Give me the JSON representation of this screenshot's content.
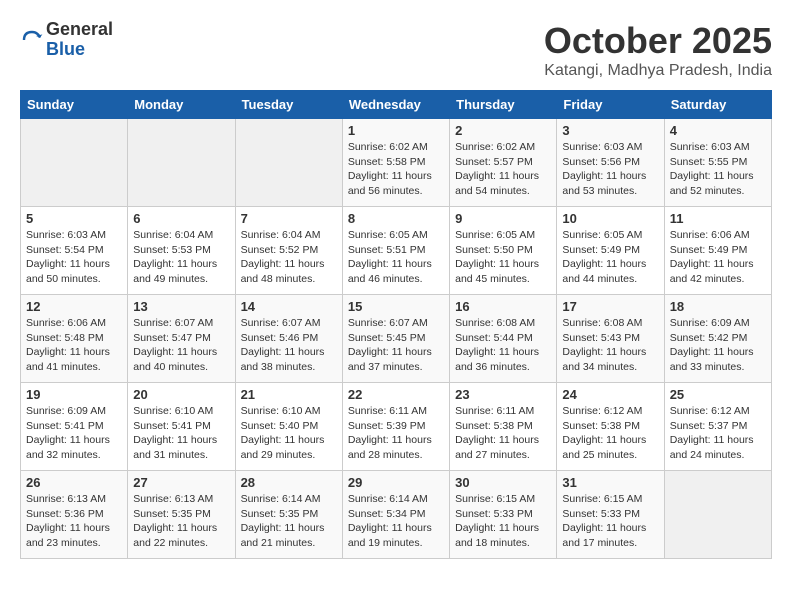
{
  "logo": {
    "general": "General",
    "blue": "Blue"
  },
  "header": {
    "title": "October 2025",
    "subtitle": "Katangi, Madhya Pradesh, India"
  },
  "weekdays": [
    "Sunday",
    "Monday",
    "Tuesday",
    "Wednesday",
    "Thursday",
    "Friday",
    "Saturday"
  ],
  "weeks": [
    [
      {
        "day": "",
        "empty": true
      },
      {
        "day": "",
        "empty": true
      },
      {
        "day": "",
        "empty": true
      },
      {
        "day": "1",
        "sunrise": "6:02 AM",
        "sunset": "5:58 PM",
        "daylight": "11 hours and 56 minutes."
      },
      {
        "day": "2",
        "sunrise": "6:02 AM",
        "sunset": "5:57 PM",
        "daylight": "11 hours and 54 minutes."
      },
      {
        "day": "3",
        "sunrise": "6:03 AM",
        "sunset": "5:56 PM",
        "daylight": "11 hours and 53 minutes."
      },
      {
        "day": "4",
        "sunrise": "6:03 AM",
        "sunset": "5:55 PM",
        "daylight": "11 hours and 52 minutes."
      }
    ],
    [
      {
        "day": "5",
        "sunrise": "6:03 AM",
        "sunset": "5:54 PM",
        "daylight": "11 hours and 50 minutes."
      },
      {
        "day": "6",
        "sunrise": "6:04 AM",
        "sunset": "5:53 PM",
        "daylight": "11 hours and 49 minutes."
      },
      {
        "day": "7",
        "sunrise": "6:04 AM",
        "sunset": "5:52 PM",
        "daylight": "11 hours and 48 minutes."
      },
      {
        "day": "8",
        "sunrise": "6:05 AM",
        "sunset": "5:51 PM",
        "daylight": "11 hours and 46 minutes."
      },
      {
        "day": "9",
        "sunrise": "6:05 AM",
        "sunset": "5:50 PM",
        "daylight": "11 hours and 45 minutes."
      },
      {
        "day": "10",
        "sunrise": "6:05 AM",
        "sunset": "5:49 PM",
        "daylight": "11 hours and 44 minutes."
      },
      {
        "day": "11",
        "sunrise": "6:06 AM",
        "sunset": "5:49 PM",
        "daylight": "11 hours and 42 minutes."
      }
    ],
    [
      {
        "day": "12",
        "sunrise": "6:06 AM",
        "sunset": "5:48 PM",
        "daylight": "11 hours and 41 minutes."
      },
      {
        "day": "13",
        "sunrise": "6:07 AM",
        "sunset": "5:47 PM",
        "daylight": "11 hours and 40 minutes."
      },
      {
        "day": "14",
        "sunrise": "6:07 AM",
        "sunset": "5:46 PM",
        "daylight": "11 hours and 38 minutes."
      },
      {
        "day": "15",
        "sunrise": "6:07 AM",
        "sunset": "5:45 PM",
        "daylight": "11 hours and 37 minutes."
      },
      {
        "day": "16",
        "sunrise": "6:08 AM",
        "sunset": "5:44 PM",
        "daylight": "11 hours and 36 minutes."
      },
      {
        "day": "17",
        "sunrise": "6:08 AM",
        "sunset": "5:43 PM",
        "daylight": "11 hours and 34 minutes."
      },
      {
        "day": "18",
        "sunrise": "6:09 AM",
        "sunset": "5:42 PM",
        "daylight": "11 hours and 33 minutes."
      }
    ],
    [
      {
        "day": "19",
        "sunrise": "6:09 AM",
        "sunset": "5:41 PM",
        "daylight": "11 hours and 32 minutes."
      },
      {
        "day": "20",
        "sunrise": "6:10 AM",
        "sunset": "5:41 PM",
        "daylight": "11 hours and 31 minutes."
      },
      {
        "day": "21",
        "sunrise": "6:10 AM",
        "sunset": "5:40 PM",
        "daylight": "11 hours and 29 minutes."
      },
      {
        "day": "22",
        "sunrise": "6:11 AM",
        "sunset": "5:39 PM",
        "daylight": "11 hours and 28 minutes."
      },
      {
        "day": "23",
        "sunrise": "6:11 AM",
        "sunset": "5:38 PM",
        "daylight": "11 hours and 27 minutes."
      },
      {
        "day": "24",
        "sunrise": "6:12 AM",
        "sunset": "5:38 PM",
        "daylight": "11 hours and 25 minutes."
      },
      {
        "day": "25",
        "sunrise": "6:12 AM",
        "sunset": "5:37 PM",
        "daylight": "11 hours and 24 minutes."
      }
    ],
    [
      {
        "day": "26",
        "sunrise": "6:13 AM",
        "sunset": "5:36 PM",
        "daylight": "11 hours and 23 minutes."
      },
      {
        "day": "27",
        "sunrise": "6:13 AM",
        "sunset": "5:35 PM",
        "daylight": "11 hours and 22 minutes."
      },
      {
        "day": "28",
        "sunrise": "6:14 AM",
        "sunset": "5:35 PM",
        "daylight": "11 hours and 21 minutes."
      },
      {
        "day": "29",
        "sunrise": "6:14 AM",
        "sunset": "5:34 PM",
        "daylight": "11 hours and 19 minutes."
      },
      {
        "day": "30",
        "sunrise": "6:15 AM",
        "sunset": "5:33 PM",
        "daylight": "11 hours and 18 minutes."
      },
      {
        "day": "31",
        "sunrise": "6:15 AM",
        "sunset": "5:33 PM",
        "daylight": "11 hours and 17 minutes."
      },
      {
        "day": "",
        "empty": true
      }
    ]
  ],
  "labels": {
    "sunrise": "Sunrise:",
    "sunset": "Sunset:",
    "daylight": "Daylight:"
  }
}
